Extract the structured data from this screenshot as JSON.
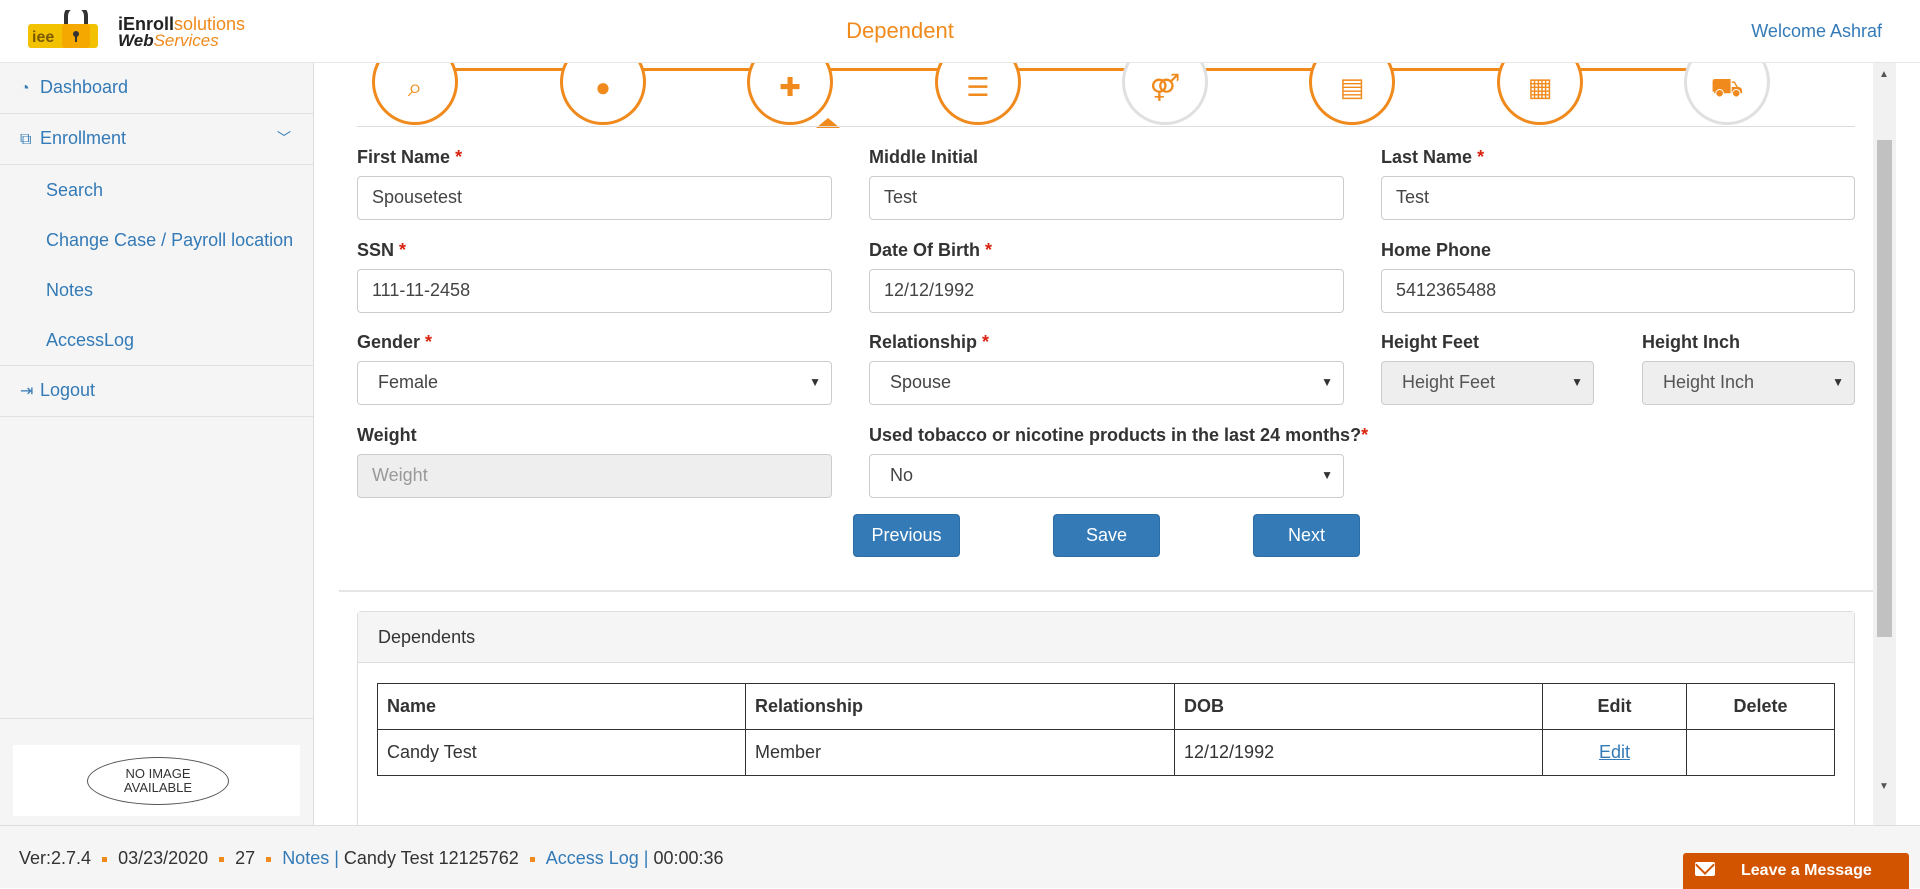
{
  "header": {
    "logo_text_1a": "iEnroll",
    "logo_text_1b": "solutions",
    "logo_text_2a": "Web",
    "logo_text_2b": "Services",
    "title": "Dependent",
    "welcome": "Welcome Ashraf"
  },
  "sidebar": {
    "dashboard": "Dashboard",
    "enrollment": "Enrollment",
    "search": "Search",
    "change_case": "Change Case / Payroll location",
    "notes": "Notes",
    "access_log": "AccessLog",
    "logout": "Logout",
    "no_image_1": "NO IMAGE",
    "no_image_2": "AVAILABLE"
  },
  "steps": {
    "icons": [
      "search-icon",
      "user-icon",
      "add-user-icon",
      "list-icon",
      "family-icon",
      "document-icon",
      "form-icon",
      "cart-icon"
    ],
    "active_index": 2,
    "glyphs": [
      "⌕",
      "●",
      "✚",
      "☰",
      "⚤",
      "▤",
      "▦",
      "⛟"
    ]
  },
  "form": {
    "first_name": {
      "label": "First Name",
      "value": "Spousetest"
    },
    "middle_initial": {
      "label": "Middle Initial",
      "value": "Test"
    },
    "last_name": {
      "label": "Last Name",
      "value": "Test"
    },
    "ssn": {
      "label": "SSN",
      "value": "111-11-2458"
    },
    "dob": {
      "label": "Date Of Birth",
      "value": "12/12/1992"
    },
    "home_phone": {
      "label": "Home Phone",
      "value": "5412365488"
    },
    "gender": {
      "label": "Gender",
      "value": "Female"
    },
    "relationship": {
      "label": "Relationship",
      "value": "Spouse"
    },
    "height_feet": {
      "label": "Height Feet",
      "value": "Height Feet"
    },
    "height_inch": {
      "label": "Height Inch",
      "value": "Height Inch"
    },
    "weight": {
      "label": "Weight",
      "placeholder": "Weight"
    },
    "tobacco": {
      "label": "Used tobacco or nicotine products in the last 24 months?",
      "value": "No"
    },
    "required_mark": "*"
  },
  "buttons": {
    "previous": "Previous",
    "save": "Save",
    "next": "Next"
  },
  "dependents": {
    "title": "Dependents",
    "columns": [
      "Name",
      "Relationship",
      "DOB",
      "Edit",
      "Delete"
    ],
    "rows": [
      {
        "name": "Candy Test",
        "relationship": "Member",
        "dob": "12/12/1992",
        "edit": "Edit",
        "delete": ""
      }
    ]
  },
  "footer": {
    "version": "Ver:2.7.4",
    "date": "03/23/2020",
    "count": "27",
    "notes": "Notes |",
    "member": "Candy Test 12125762",
    "access_log": "Access Log |",
    "timer": "00:00:36",
    "leave_message": "Leave a Message"
  },
  "colors": {
    "accent": "#f08a1c",
    "link": "#337ab7",
    "button": "#337ab7",
    "leave_message": "#d35400"
  }
}
